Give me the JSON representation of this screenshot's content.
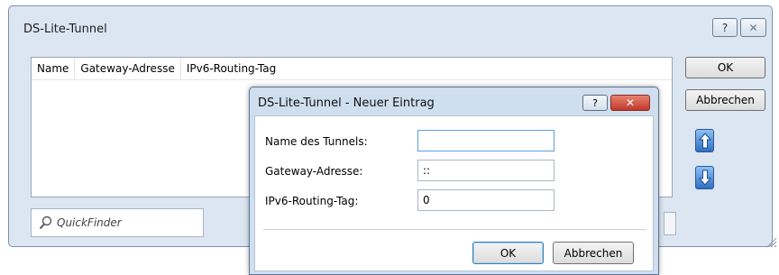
{
  "outer": {
    "title": "DS-Lite-Tunnel",
    "help_glyph": "?",
    "close_glyph": "✕",
    "columns": [
      "Name",
      "Gateway-Adresse",
      "IPv6-Routing-Tag"
    ],
    "ok_label": "OK",
    "cancel_label": "Abbrechen",
    "quickfinder_placeholder": "QuickFinder"
  },
  "dialog": {
    "title": "DS-Lite-Tunnel - Neuer Eintrag",
    "help_glyph": "?",
    "close_glyph": "✕",
    "fields": [
      {
        "label": "Name des Tunnels:",
        "value": ""
      },
      {
        "label": "Gateway-Adresse:",
        "value": "::"
      },
      {
        "label": "IPv6-Routing-Tag:",
        "value": "0"
      }
    ],
    "ok_label": "OK",
    "cancel_label": "Abbrechen"
  },
  "colors": {
    "accent": "#2f6fc4",
    "window_bg": "#dce6f2",
    "close_red": "#c0392b"
  }
}
